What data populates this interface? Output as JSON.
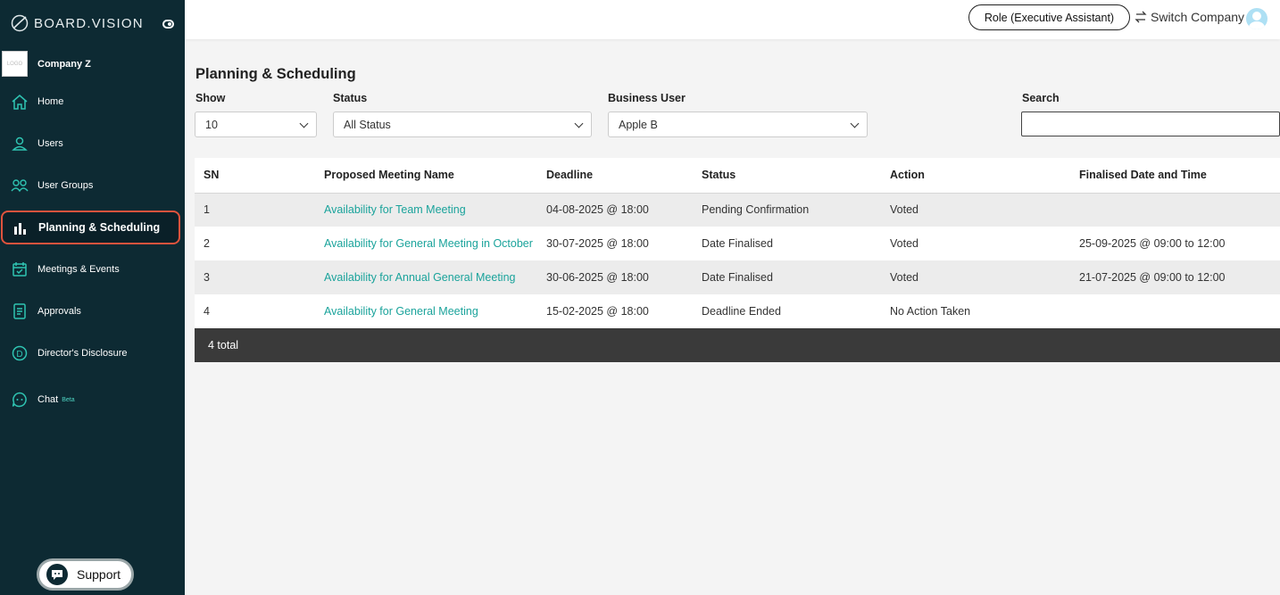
{
  "brand": {
    "name": "BOARD.VISION"
  },
  "company": {
    "logo_text": "LOGO",
    "name": "Company Z"
  },
  "sidebar": {
    "items": [
      {
        "label": "Home",
        "icon": "home-icon"
      },
      {
        "label": "Users",
        "icon": "user-icon"
      },
      {
        "label": "User Groups",
        "icon": "user-group-icon"
      },
      {
        "label": "Planning & Scheduling",
        "icon": "bar-chart-icon",
        "active": true
      },
      {
        "label": "Meetings & Events",
        "icon": "calendar-check-icon"
      },
      {
        "label": "Approvals",
        "icon": "document-icon"
      },
      {
        "label": "Director's Disclosure",
        "icon": "d-circle-icon"
      },
      {
        "label": "Chat",
        "badge": "Beta",
        "icon": "chat-icon"
      }
    ],
    "support_label": "Support"
  },
  "topbar": {
    "role_label": "Role (Executive Assistant)",
    "switch_label": "Switch Company"
  },
  "main": {
    "title": "Planning & Scheduling",
    "filters": {
      "show_label": "Show",
      "show_value": "10",
      "status_label": "Status",
      "status_value": "All Status",
      "business_user_label": "Business User",
      "business_user_value": "Apple B",
      "search_label": "Search",
      "search_value": ""
    },
    "table": {
      "headers": [
        "SN",
        "Proposed Meeting Name",
        "Deadline",
        "Status",
        "Action",
        "Finalised Date and Time"
      ],
      "rows": [
        [
          "1",
          "Availability for Team Meeting",
          "04-08-2025 @ 18:00",
          "Pending Confirmation",
          "Voted",
          ""
        ],
        [
          "2",
          "Availability for General Meeting in October",
          "30-07-2025 @ 18:00",
          "Date Finalised",
          "Voted",
          "25-09-2025 @ 09:00 to 12:00"
        ],
        [
          "3",
          "Availability for Annual General Meeting",
          "30-06-2025 @ 18:00",
          "Date Finalised",
          "Voted",
          "21-07-2025 @ 09:00 to 12:00"
        ],
        [
          "4",
          "Availability for General Meeting",
          "15-02-2025 @ 18:00",
          "Deadline Ended",
          "No Action Taken",
          ""
        ]
      ],
      "total_label": "4 total"
    }
  },
  "colors": {
    "sidebar_bg": "#0d2a33",
    "accent_teal": "#1aa39b",
    "active_border": "#e0533d",
    "footer_bg": "#3a3a3a"
  }
}
